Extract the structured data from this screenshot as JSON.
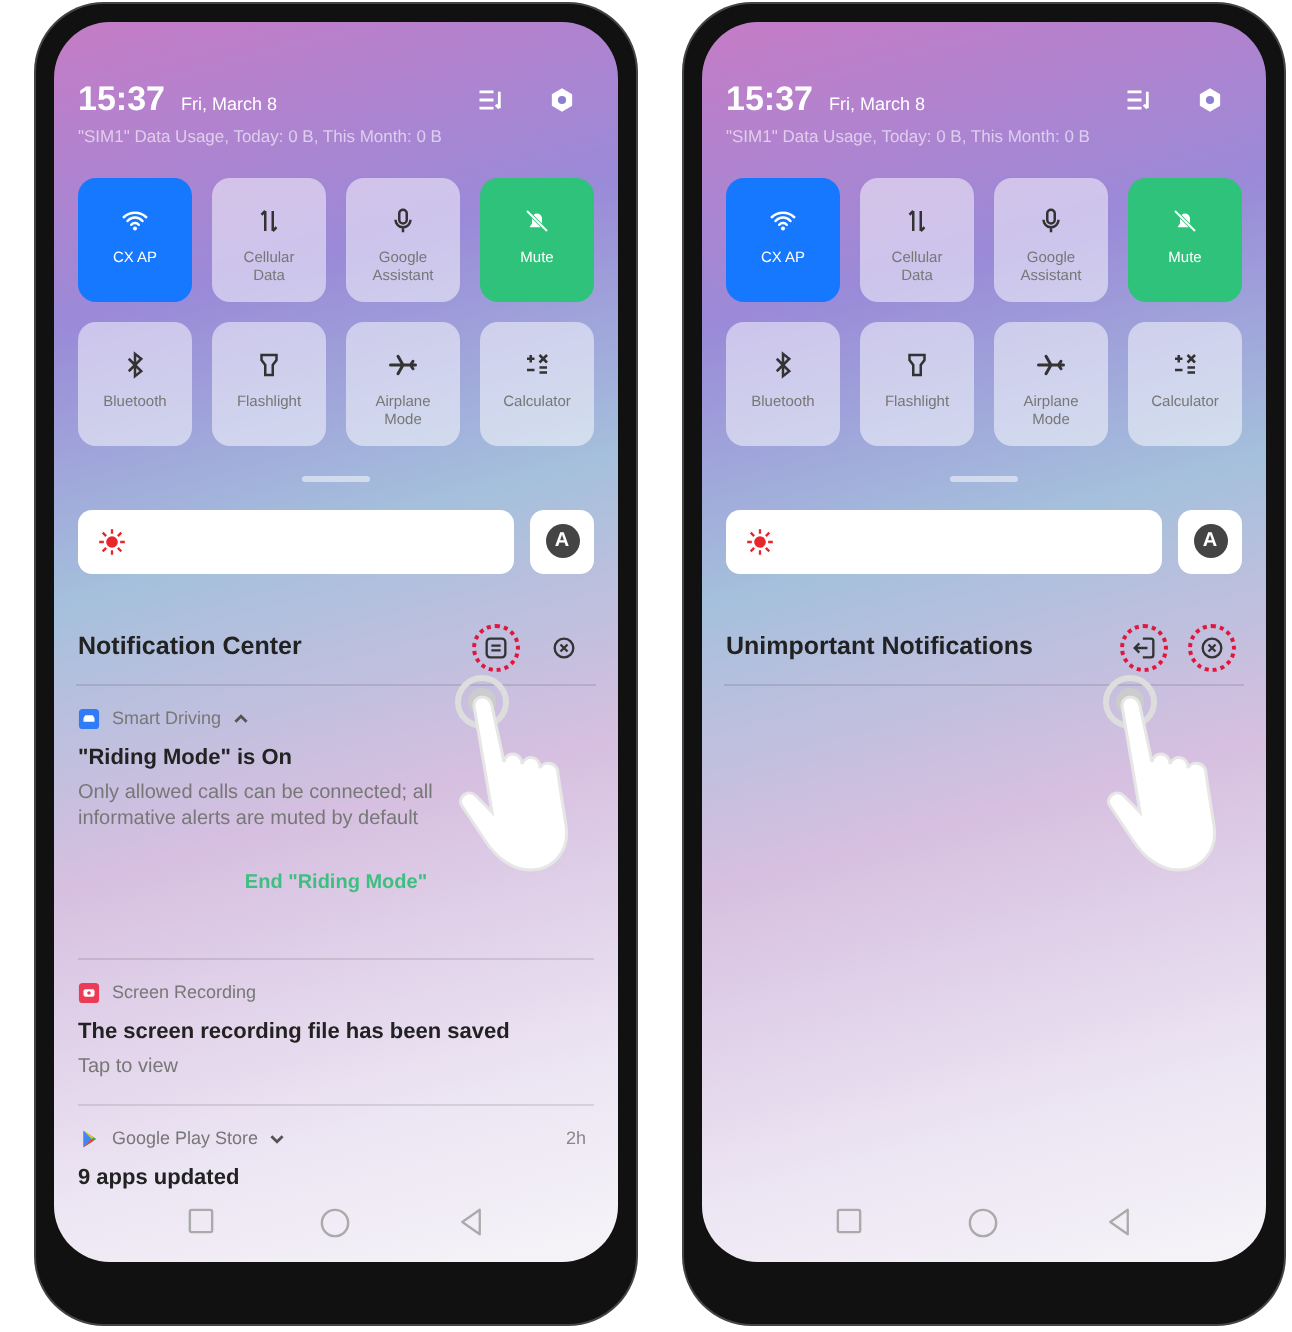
{
  "phones": [
    {
      "time": "15:37",
      "date": "Fri, March 8",
      "data_usage": "\"SIM1\" Data Usage, Today: 0 B, This Month: 0 B",
      "tiles": [
        {
          "label": "CX AP",
          "on": true,
          "color": "#1677ff"
        },
        {
          "label": "Cellular Data",
          "on": false
        },
        {
          "label": "Google Assistant",
          "on": false
        },
        {
          "label": "Mute",
          "on": true,
          "color": "#2fc27a"
        },
        {
          "label": "Bluetooth",
          "on": false
        },
        {
          "label": "Flashlight",
          "on": false
        },
        {
          "label": "Airplane Mode",
          "on": false
        },
        {
          "label": "Calculator",
          "on": false
        }
      ],
      "brightness": {
        "level": 0,
        "auto_label": "A"
      },
      "panel_title": "Notification Center",
      "actions": [
        {
          "kind": "list",
          "highlighted": true
        },
        {
          "kind": "close",
          "highlighted": false
        }
      ],
      "notifications": [
        {
          "app": "Smart Driving",
          "kind": "car",
          "expanded": true,
          "title": "\"Riding Mode\" is On",
          "body": "Only allowed calls can be connected; all informative alerts are muted by default",
          "action": "End \"Riding Mode\""
        },
        {
          "app": "Screen Recording",
          "kind": "record",
          "title": "The screen recording file has been saved",
          "body": "Tap to view"
        },
        {
          "app": "Google Play Store",
          "kind": "play",
          "expanded": false,
          "time": "2h",
          "title": "9 apps updated"
        }
      ]
    },
    {
      "time": "15:37",
      "date": "Fri, March 8",
      "data_usage": "\"SIM1\" Data Usage, Today: 0 B, This Month: 0 B",
      "tiles": [
        {
          "label": "CX AP",
          "on": true,
          "color": "#1677ff"
        },
        {
          "label": "Cellular Data",
          "on": false
        },
        {
          "label": "Google Assistant",
          "on": false
        },
        {
          "label": "Mute",
          "on": true,
          "color": "#2fc27a"
        },
        {
          "label": "Bluetooth",
          "on": false
        },
        {
          "label": "Flashlight",
          "on": false
        },
        {
          "label": "Airplane Mode",
          "on": false
        },
        {
          "label": "Calculator",
          "on": false
        }
      ],
      "brightness": {
        "level": 0,
        "auto_label": "A"
      },
      "panel_title": "Unimportant Notifications",
      "actions": [
        {
          "kind": "exit",
          "highlighted": true
        },
        {
          "kind": "close",
          "highlighted": true
        }
      ]
    }
  ]
}
